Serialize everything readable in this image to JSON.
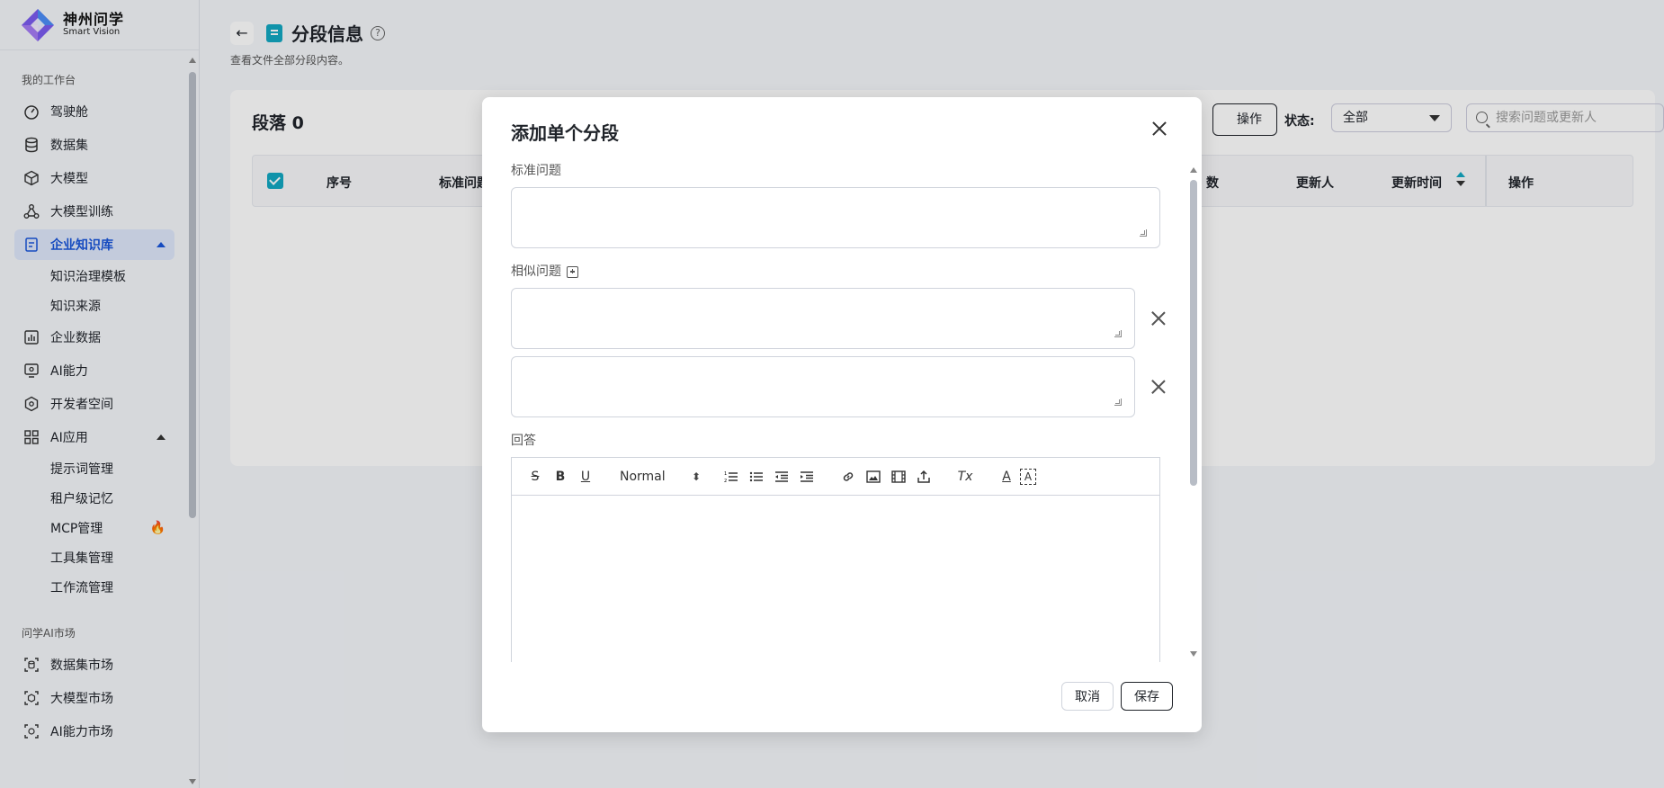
{
  "brand": {
    "name_cn": "神州问学",
    "name_en": "Smart Vision"
  },
  "sidebar": {
    "section_workspace": "我的工作台",
    "items": [
      {
        "label": "驾驶舱",
        "icon": "dashboard-icon"
      },
      {
        "label": "数据集",
        "icon": "database-icon"
      },
      {
        "label": "大模型",
        "icon": "cube-icon"
      },
      {
        "label": "大模型训练",
        "icon": "training-icon"
      },
      {
        "label": "企业知识库",
        "icon": "knowledge-icon",
        "active": true
      },
      {
        "label": "企业数据",
        "icon": "chart-icon"
      },
      {
        "label": "AI能力",
        "icon": "ai-monitor-icon"
      },
      {
        "label": "开发者空间",
        "icon": "developer-icon"
      },
      {
        "label": "AI应用",
        "icon": "apps-grid-icon"
      }
    ],
    "knowledge_sub": [
      "知识治理模板",
      "知识来源"
    ],
    "ai_app_sub": [
      "提示词管理",
      "租户级记忆",
      "MCP管理",
      "工具集管理",
      "工作流管理"
    ],
    "section_market": "问学AI市场",
    "market_items": [
      "数据集市场",
      "大模型市场",
      "AI能力市场"
    ]
  },
  "header": {
    "back_icon": "arrow-left-icon",
    "title": "分段信息",
    "help": "?",
    "subtitle": "查看文件全部分段内容。"
  },
  "card": {
    "title": "段落 0",
    "op_label": "操作",
    "status_label": "状态:",
    "status_value": "全部",
    "search_placeholder": "搜索问题或更新人",
    "columns": [
      "序号",
      "标准问题",
      "数",
      "更新人",
      "更新时间",
      "操作"
    ]
  },
  "modal": {
    "title": "添加单个分段",
    "standard_question_label": "标准问题",
    "similar_question_label": "相似问题",
    "answer_label": "回答",
    "editor_format": "Normal",
    "toolbar": {
      "strike": "S",
      "bold": "B",
      "underline": "U",
      "clear_format": "Tx",
      "text_color": "A",
      "highlight": "A"
    },
    "cancel_label": "取消",
    "save_label": "保存"
  }
}
